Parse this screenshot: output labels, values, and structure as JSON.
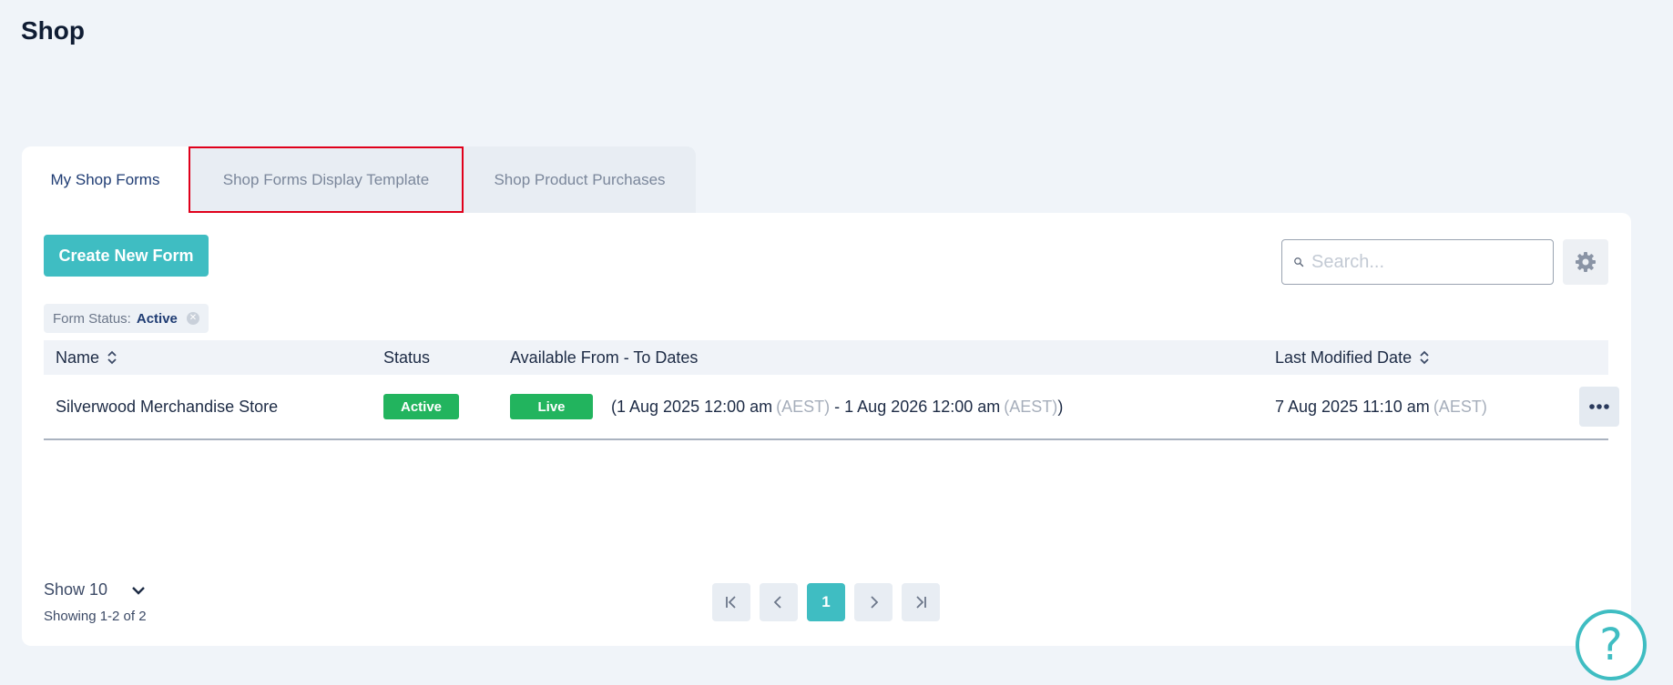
{
  "page": {
    "title": "Shop"
  },
  "tabs": [
    {
      "label": "My Shop Forms",
      "active": true
    },
    {
      "label": "Shop Forms Display Template",
      "active": false
    },
    {
      "label": "Shop Product Purchases",
      "active": false
    }
  ],
  "toolbar": {
    "create_label": "Create New Form",
    "search_placeholder": "Search...",
    "search_value": ""
  },
  "filter": {
    "label": "Form Status:",
    "value": "Active"
  },
  "table": {
    "headers": {
      "name": "Name",
      "status": "Status",
      "dates": "Available From - To Dates",
      "modified": "Last Modified Date"
    },
    "rows": [
      {
        "name": "Silverwood Merchandise Store",
        "status": "Active",
        "live": "Live",
        "open_paren": "(",
        "from": "1 Aug 2025 12:00 am",
        "tz1": "(AEST)",
        "sep": " - ",
        "to": "1 Aug 2026 12:00 am",
        "tz2": "(AEST)",
        "close_paren": ")",
        "modified": "7 Aug 2025 11:10 am",
        "modified_tz": "(AEST)"
      }
    ]
  },
  "footer": {
    "show_label": "Show 10",
    "showing_text": "Showing 1-2 of 2",
    "current_page": "1"
  },
  "colors": {
    "accent": "#3fbdc2",
    "status_green": "#22b45e",
    "highlight_border": "#e0001b"
  },
  "icons": [
    "search-icon",
    "gear-icon",
    "sort-icon",
    "more-icon",
    "chevron-down-icon",
    "first-page-icon",
    "prev-page-icon",
    "next-page-icon",
    "last-page-icon",
    "help-icon"
  ]
}
